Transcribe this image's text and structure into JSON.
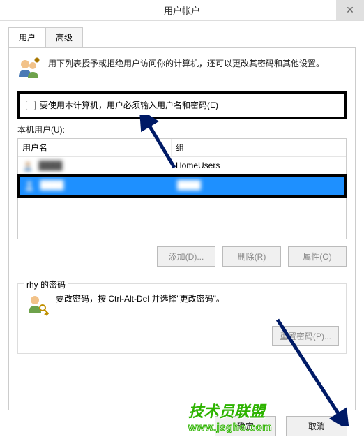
{
  "titlebar": {
    "title": "用户帐户",
    "close": "✕"
  },
  "tabs": {
    "users": "用户",
    "advanced": "高级"
  },
  "intro": "用下列表授予或拒绝用户访问你的计算机，还可以更改其密码和其他设置。",
  "checkbox": {
    "label": "要使用本计算机，用户必须输入用户名和密码(E)"
  },
  "local_users_label": "本机用户(U):",
  "list": {
    "header_name": "用户名",
    "header_group": "组",
    "rows": [
      {
        "name": "████",
        "group": "HomeUsers"
      },
      {
        "name": "████",
        "group": "████"
      }
    ]
  },
  "buttons": {
    "add": "添加(D)...",
    "delete": "删除(R)",
    "properties": "属性(O)"
  },
  "password": {
    "section_label": "rhy 的密码",
    "text": "要改密码，按 Ctrl-Alt-Del 并选择\"更改密码\"。",
    "reset_btn": "重置密码(P)..."
  },
  "dialog_buttons": {
    "ok": "确定",
    "cancel": "取消"
  },
  "watermark": {
    "name": "技术员联盟",
    "url": "www.jsgho.com"
  }
}
